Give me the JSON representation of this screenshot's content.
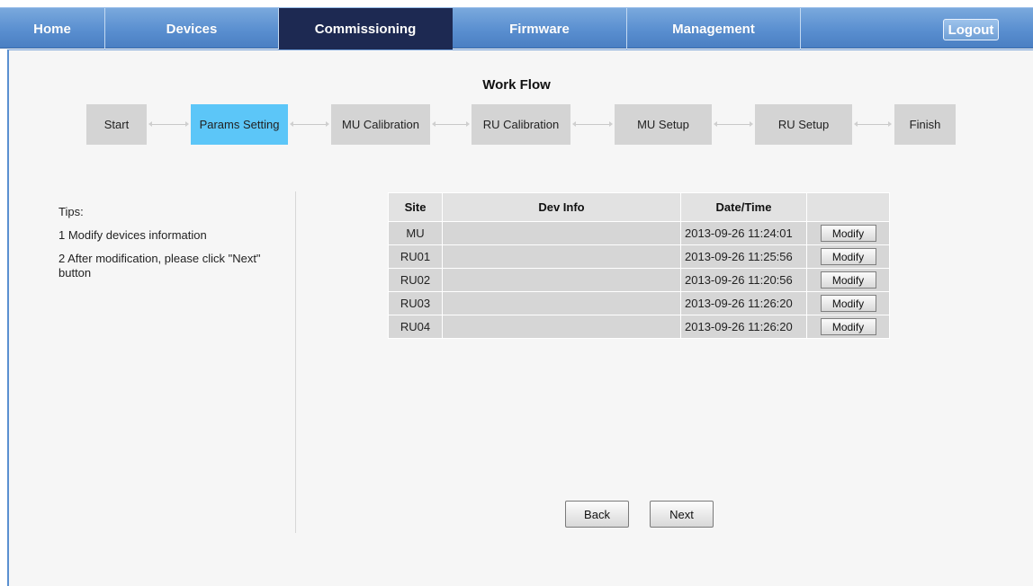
{
  "nav": {
    "tabs": [
      {
        "label": "Home"
      },
      {
        "label": "Devices"
      },
      {
        "label": "Commissioning"
      },
      {
        "label": "Firmware"
      },
      {
        "label": "Management"
      }
    ],
    "logout_label": "Logout"
  },
  "workflow": {
    "title": "Work Flow",
    "steps": [
      {
        "label": "Start"
      },
      {
        "label": "Params Setting"
      },
      {
        "label": "MU Calibration"
      },
      {
        "label": "RU Calibration"
      },
      {
        "label": "MU Setup"
      },
      {
        "label": "RU Setup"
      },
      {
        "label": "Finish"
      }
    ],
    "active_step": "Params Setting"
  },
  "tips": {
    "heading": "Tips:",
    "lines": [
      "1 Modify devices information",
      "2 After modification, please click \"Next\" button"
    ]
  },
  "table": {
    "headers": [
      "Site",
      "Dev Info",
      "Date/Time",
      ""
    ],
    "rows": [
      {
        "site": "MU",
        "dev_info": "",
        "datetime": "2013-09-26 11:24:01",
        "action": "Modify"
      },
      {
        "site": "RU01",
        "dev_info": "",
        "datetime": "2013-09-26 11:25:56",
        "action": "Modify"
      },
      {
        "site": "RU02",
        "dev_info": "",
        "datetime": "2013-09-26 11:20:56",
        "action": "Modify"
      },
      {
        "site": "RU03",
        "dev_info": "",
        "datetime": "2013-09-26 11:26:20",
        "action": "Modify"
      },
      {
        "site": "RU04",
        "dev_info": "",
        "datetime": "2013-09-26 11:26:20",
        "action": "Modify"
      }
    ]
  },
  "buttons": {
    "back_label": "Back",
    "next_label": "Next"
  },
  "colors": {
    "nav_blue": "#5a8fd0",
    "active_tab": "#1d2952",
    "active_step": "#5cc6f8",
    "step_gray": "#d4d4d4"
  }
}
